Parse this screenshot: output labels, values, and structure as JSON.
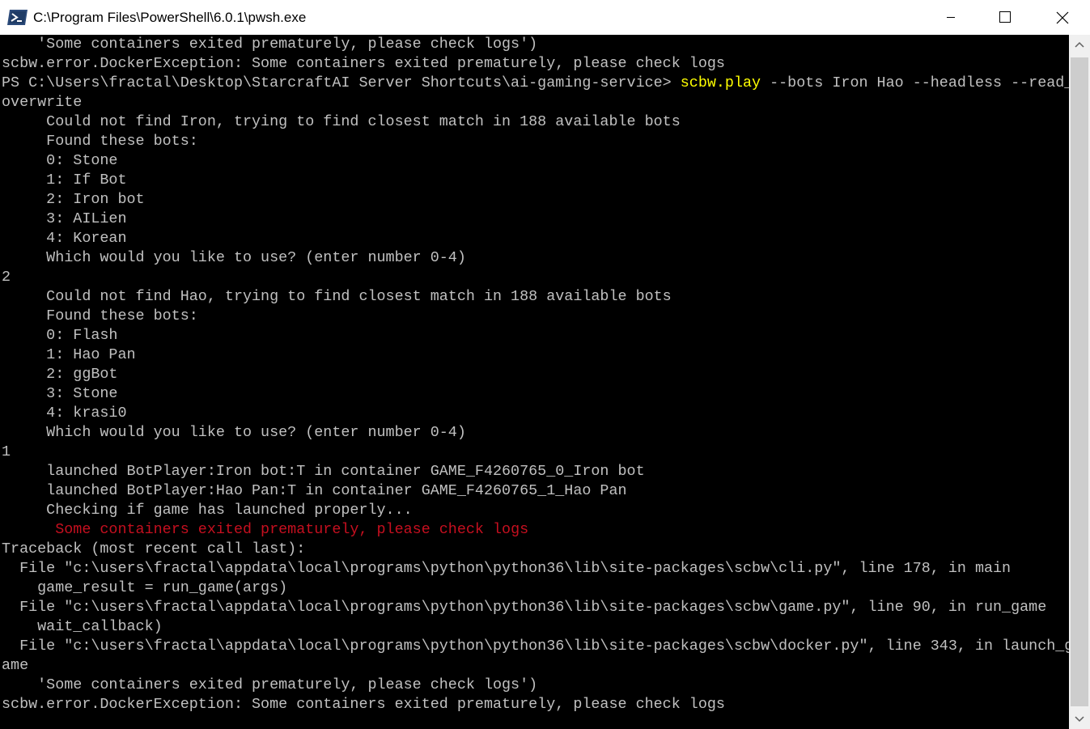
{
  "window": {
    "title": "C:\\Program Files\\PowerShell\\6.0.1\\pwsh.exe",
    "icon": "powershell-icon"
  },
  "colors": {
    "console_bg": "#000000",
    "text": "#c0c0c0",
    "command": "#ffff00",
    "error": "#c50f1f"
  },
  "console": {
    "lines": [
      {
        "parts": [
          {
            "t": "    'Some containers exited prematurely, please check logs')"
          }
        ]
      },
      {
        "parts": [
          {
            "t": "scbw.error.DockerException: Some containers exited prematurely, please check logs"
          }
        ]
      },
      {
        "parts": [
          {
            "t": "PS C:\\Users\\fractal\\Desktop\\StarcraftAI Server Shortcuts\\ai-gaming-service> "
          },
          {
            "t": "scbw.play",
            "c": "cmd"
          },
          {
            "t": " --bots Iron Hao --headless --read_"
          }
        ]
      },
      {
        "parts": [
          {
            "t": "overwrite"
          }
        ]
      },
      {
        "parts": [
          {
            "t": "     Could not find Iron, trying to find closest match in 188 available bots"
          }
        ]
      },
      {
        "parts": [
          {
            "t": "     Found these bots:"
          }
        ]
      },
      {
        "parts": [
          {
            "t": "     0: Stone"
          }
        ]
      },
      {
        "parts": [
          {
            "t": "     1: If Bot"
          }
        ]
      },
      {
        "parts": [
          {
            "t": "     2: Iron bot"
          }
        ]
      },
      {
        "parts": [
          {
            "t": "     3: AILien"
          }
        ]
      },
      {
        "parts": [
          {
            "t": "     4: Korean"
          }
        ]
      },
      {
        "parts": [
          {
            "t": "     Which would you like to use? (enter number 0-4)"
          }
        ]
      },
      {
        "parts": [
          {
            "t": "2"
          }
        ]
      },
      {
        "parts": [
          {
            "t": "     Could not find Hao, trying to find closest match in 188 available bots"
          }
        ]
      },
      {
        "parts": [
          {
            "t": "     Found these bots:"
          }
        ]
      },
      {
        "parts": [
          {
            "t": "     0: Flash"
          }
        ]
      },
      {
        "parts": [
          {
            "t": "     1: Hao Pan"
          }
        ]
      },
      {
        "parts": [
          {
            "t": "     2: ggBot"
          }
        ]
      },
      {
        "parts": [
          {
            "t": "     3: Stone"
          }
        ]
      },
      {
        "parts": [
          {
            "t": "     4: krasi0"
          }
        ]
      },
      {
        "parts": [
          {
            "t": "     Which would you like to use? (enter number 0-4)"
          }
        ]
      },
      {
        "parts": [
          {
            "t": "1"
          }
        ]
      },
      {
        "parts": [
          {
            "t": "     launched BotPlayer:Iron bot:T in container GAME_F4260765_0_Iron bot"
          }
        ]
      },
      {
        "parts": [
          {
            "t": "     launched BotPlayer:Hao Pan:T in container GAME_F4260765_1_Hao Pan"
          }
        ]
      },
      {
        "parts": [
          {
            "t": "     Checking if game has launched properly..."
          }
        ]
      },
      {
        "parts": [
          {
            "t": "      "
          },
          {
            "t": "Some containers exited prematurely, please check logs",
            "c": "err"
          }
        ]
      },
      {
        "parts": [
          {
            "t": "Traceback (most recent call last):"
          }
        ]
      },
      {
        "parts": [
          {
            "t": "  File \"c:\\users\\fractal\\appdata\\local\\programs\\python\\python36\\lib\\site-packages\\scbw\\cli.py\", line 178, in main"
          }
        ]
      },
      {
        "parts": [
          {
            "t": "    game_result = run_game(args)"
          }
        ]
      },
      {
        "parts": [
          {
            "t": "  File \"c:\\users\\fractal\\appdata\\local\\programs\\python\\python36\\lib\\site-packages\\scbw\\game.py\", line 90, in run_game"
          }
        ]
      },
      {
        "parts": [
          {
            "t": "    wait_callback)"
          }
        ]
      },
      {
        "parts": [
          {
            "t": "  File \"c:\\users\\fractal\\appdata\\local\\programs\\python\\python36\\lib\\site-packages\\scbw\\docker.py\", line 343, in launch_g"
          }
        ]
      },
      {
        "parts": [
          {
            "t": "ame"
          }
        ]
      },
      {
        "parts": [
          {
            "t": "    'Some containers exited prematurely, please check logs')"
          }
        ]
      },
      {
        "parts": [
          {
            "t": "scbw.error.DockerException: Some containers exited prematurely, please check logs"
          }
        ]
      }
    ]
  }
}
